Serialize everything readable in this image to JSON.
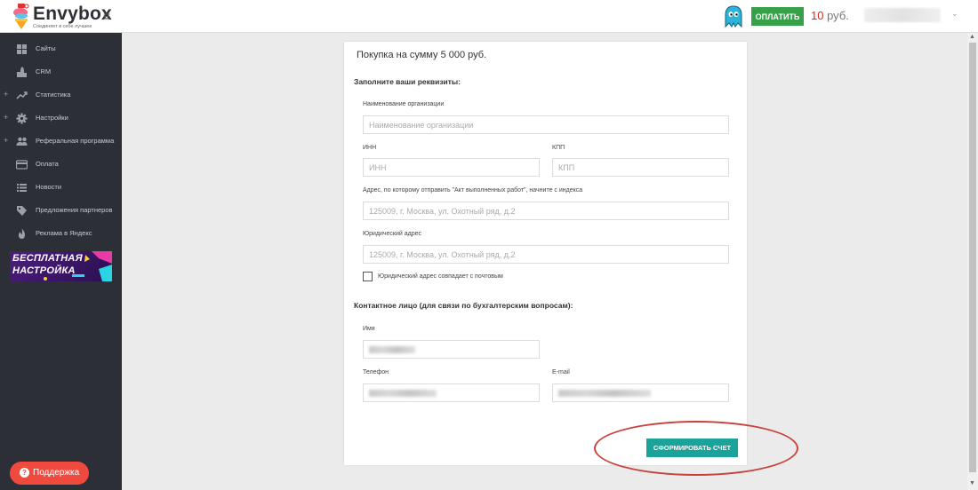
{
  "header": {
    "brand": "Envybox",
    "tagline": "Соединяет в себе лучшее",
    "pay_label": "ОПЛАТИТЬ",
    "balance_value": "10",
    "balance_currency": "руб."
  },
  "sidebar": {
    "items": [
      {
        "label": "Сайты",
        "icon": "grid-icon",
        "expandable": false
      },
      {
        "label": "CRM",
        "icon": "crm-icon",
        "expandable": false
      },
      {
        "label": "Статистика",
        "icon": "trend-icon",
        "expandable": true
      },
      {
        "label": "Настройки",
        "icon": "gear-icon",
        "expandable": true
      },
      {
        "label": "Реферальная программа",
        "icon": "users-icon",
        "expandable": true
      },
      {
        "label": "Оплата",
        "icon": "credit-card-icon",
        "expandable": false
      },
      {
        "label": "Новости",
        "icon": "list-icon",
        "expandable": false
      },
      {
        "label": "Предложения партнеров",
        "icon": "tag-icon",
        "expandable": false
      },
      {
        "label": "Реклама в Яндекс",
        "icon": "flame-icon",
        "expandable": false
      }
    ],
    "promo_line1": "БЕСПЛАТНАЯ",
    "promo_line2": "НАСТРОЙКА",
    "support_label": "Поддержка"
  },
  "form": {
    "title": "Покупка на сумму 5 000 руб.",
    "requisites_heading": "Заполните ваши реквизиты:",
    "org_label": "Наименование организации",
    "org_placeholder": "Наименование организации",
    "inn_label": "ИНН",
    "inn_placeholder": "ИНН",
    "kpp_label": "КПП",
    "kpp_placeholder": "КПП",
    "postal_label": "Адрес, по которому отправить \"Акт выполненных работ\", начните с индекса",
    "postal_placeholder": "125009, г. Москва, ул. Охотный ряд, д.2",
    "legal_label": "Юридический адрес",
    "legal_placeholder": "125009, г. Москва, ул. Охотный ряд, д.2",
    "same_address_label": "Юридический адрес совпадает с почтовым",
    "contact_heading": "Контактное лицо (для связи по бухгалтерским вопросам):",
    "name_label": "Имя",
    "phone_label": "Телефон",
    "email_label": "E-mail",
    "submit_label": "СФОРМИРОВАТЬ СЧЕТ"
  },
  "colors": {
    "sidebar_bg": "#2c2f36",
    "pay_button": "#36a149",
    "submit_button": "#1aa39a",
    "support_button": "#f04a3f",
    "balance_red": "#e2231a",
    "annotation": "#c8413c"
  }
}
